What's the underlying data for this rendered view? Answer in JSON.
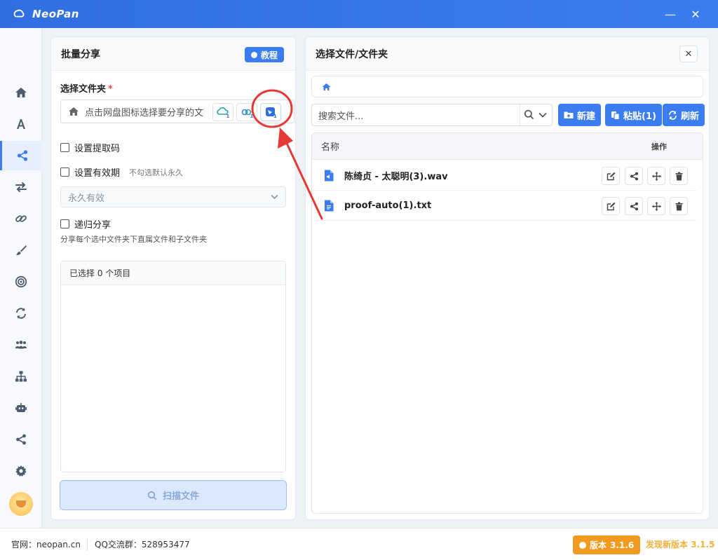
{
  "window": {
    "title": "NeoPan",
    "minimize_glyph": "—",
    "close_glyph": "✕"
  },
  "sidebar": {
    "items": [
      {
        "icon": "home-icon"
      },
      {
        "icon": "text-icon"
      },
      {
        "icon": "share-icon",
        "active": true
      },
      {
        "icon": "transfer-icon"
      },
      {
        "icon": "link-icon"
      },
      {
        "icon": "brush-icon"
      },
      {
        "icon": "target-icon"
      },
      {
        "icon": "sync-icon"
      },
      {
        "icon": "users-icon"
      },
      {
        "icon": "sitemap-icon"
      },
      {
        "icon": "robot-icon"
      },
      {
        "icon": "share-alt-icon"
      },
      {
        "icon": "gear-icon"
      }
    ]
  },
  "left_panel": {
    "title": "批量分享",
    "tutorial_label": "教程",
    "folder_label": "选择文件夹",
    "required_mark": "*",
    "folder_placeholder": "点击网盘图标选择要分享的文",
    "net_badge": "1",
    "set_code_label": "设置提取码",
    "set_expiry_label": "设置有效期",
    "expiry_hint": "不勾选默认永久",
    "expiry_select_value": "永久有效",
    "recursive_label": "递归分享",
    "recursive_hint": "分享每个选中文件夹下直属文件和子文件夹",
    "selected_summary": "已选择 0 个项目",
    "scan_button": "扫描文件"
  },
  "right_panel": {
    "title": "选择文件/文件夹",
    "close_glyph": "✕",
    "search_placeholder": "搜索文件...",
    "new_label": "新建",
    "paste_label": "粘贴(1)",
    "refresh_label": "刷新",
    "col_name": "名称",
    "col_ops": "操作",
    "files": [
      {
        "name": "陈绮贞 - 太聪明(3).wav",
        "type": "audio"
      },
      {
        "name": "proof-auto(1).txt",
        "type": "text"
      }
    ]
  },
  "footer": {
    "site": "官网：neopan.cn",
    "qq": "QQ交流群：528953477",
    "version_label": "版本",
    "version": "3.1.6",
    "new_version_label": "发现新版本",
    "new_version": "3.1.5"
  },
  "colors": {
    "accent": "#3b7cf0",
    "version_badge": "#f29a1f",
    "annotation": "#e53935"
  }
}
